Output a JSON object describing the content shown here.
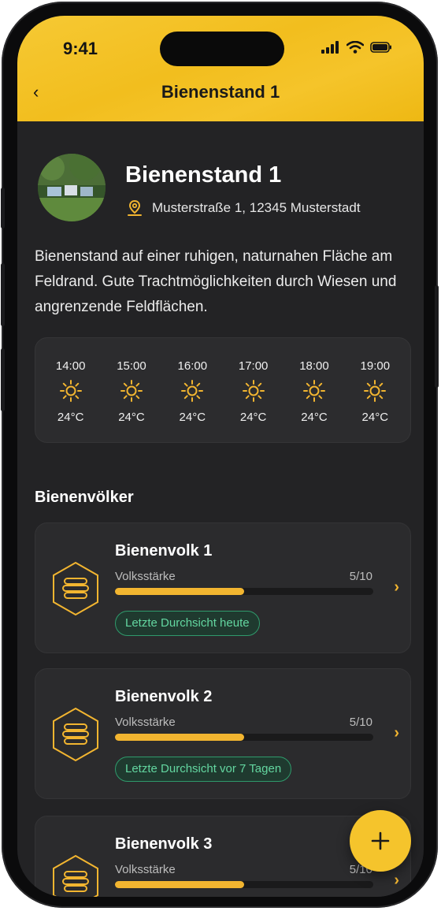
{
  "status": {
    "time": "9:41"
  },
  "nav": {
    "back_label": "‹",
    "title": "Bienenstand 1"
  },
  "apiary": {
    "name": "Bienenstand 1",
    "address": "Musterstraße 1, 12345 Musterstadt",
    "description": "Bienenstand auf einer ruhigen, naturnahen Fläche am Feldrand. Gute Trachtmöglichkeiten durch Wiesen und angrenzende Feldflächen."
  },
  "weather": [
    {
      "time": "14:00",
      "icon": "sun-icon",
      "temp": "24°C"
    },
    {
      "time": "15:00",
      "icon": "sun-icon",
      "temp": "24°C"
    },
    {
      "time": "16:00",
      "icon": "sun-icon",
      "temp": "24°C"
    },
    {
      "time": "17:00",
      "icon": "sun-icon",
      "temp": "24°C"
    },
    {
      "time": "18:00",
      "icon": "sun-icon",
      "temp": "24°C"
    },
    {
      "time": "19:00",
      "icon": "sun-icon",
      "temp": "24°C"
    }
  ],
  "colonies_section": {
    "title": "Bienenvölker"
  },
  "colonies": [
    {
      "name": "Bienenvolk 1",
      "strength_label": "Volksstärke",
      "strength_value": "5/10",
      "strength_fraction": 0.5,
      "badge": "Letzte Durchsicht heute"
    },
    {
      "name": "Bienenvolk 2",
      "strength_label": "Volksstärke",
      "strength_value": "5/10",
      "strength_fraction": 0.5,
      "badge": "Letzte Durchsicht vor 7 Tagen"
    },
    {
      "name": "Bienenvolk 3",
      "strength_label": "Volksstärke",
      "strength_value": "5/10",
      "strength_fraction": 0.5,
      "badge": ""
    }
  ],
  "fab": {
    "label": "+"
  },
  "colors": {
    "accent": "#f5c42c",
    "background": "#232325",
    "card": "#2b2b2d",
    "badge_green": "#63d6a0",
    "bar": "#f2b530"
  }
}
